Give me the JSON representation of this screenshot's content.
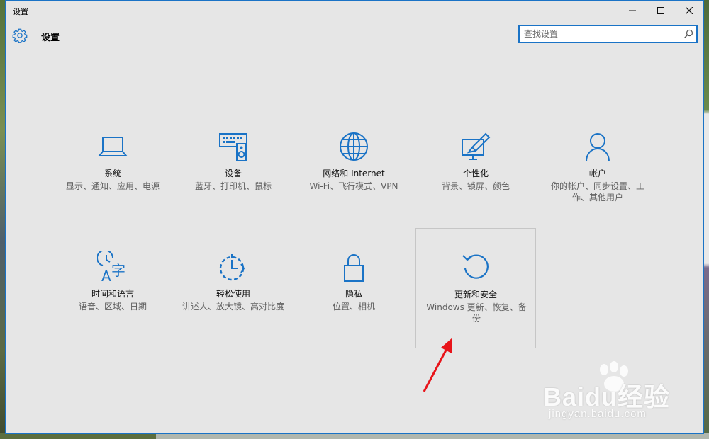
{
  "window": {
    "title": "设置",
    "controls": {
      "minimize": "—",
      "maximize": "☐",
      "close": "✕"
    }
  },
  "header": {
    "title": "设置",
    "icon": "gear-icon"
  },
  "search": {
    "placeholder": "查找设置",
    "value": ""
  },
  "tiles": [
    {
      "label": "系统",
      "desc": "显示、通知、应用、电源",
      "icon": "laptop-icon"
    },
    {
      "label": "设备",
      "desc": "蓝牙、打印机、鼠标",
      "icon": "devices-icon"
    },
    {
      "label": "网络和 Internet",
      "desc": "Wi-Fi、飞行模式、VPN",
      "icon": "globe-icon"
    },
    {
      "label": "个性化",
      "desc": "背景、锁屏、颜色",
      "icon": "personalization-icon"
    },
    {
      "label": "帐户",
      "desc": "你的帐户、同步设置、工作、其他用户",
      "icon": "person-icon"
    },
    {
      "label": "时间和语言",
      "desc": "语音、区域、日期",
      "icon": "time-language-icon"
    },
    {
      "label": "轻松使用",
      "desc": "讲述人、放大镜、高对比度",
      "icon": "ease-of-access-icon"
    },
    {
      "label": "隐私",
      "desc": "位置、相机",
      "icon": "lock-icon"
    },
    {
      "label": "更新和安全",
      "desc": "Windows 更新、恢复、备份",
      "icon": "refresh-icon"
    }
  ],
  "selected_tile": "更新和安全",
  "watermark": {
    "text": "Baidu经验",
    "sub": "jingyan.baidu.com"
  },
  "colors": {
    "accent": "#1a73c6",
    "icon": "#1a73c6",
    "background": "#e6e6e6",
    "arrow": "#e8141a"
  }
}
